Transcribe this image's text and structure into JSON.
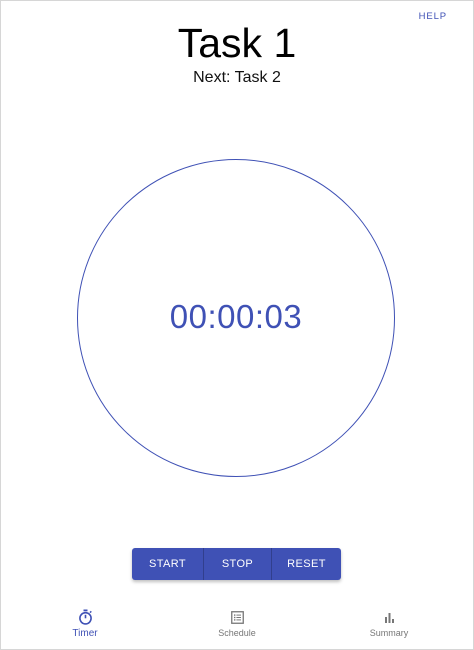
{
  "header": {
    "help_label": "HELP",
    "title": "Task 1",
    "next_task": "Next: Task 2"
  },
  "timer": {
    "display": "00:00:03"
  },
  "controls": {
    "start_label": "START",
    "stop_label": "STOP",
    "reset_label": "RESET"
  },
  "bottom_nav": {
    "items": [
      {
        "label": "Timer",
        "icon": "stopwatch-icon",
        "active": true
      },
      {
        "label": "Schedule",
        "icon": "list-icon",
        "active": false
      },
      {
        "label": "Summary",
        "icon": "bar-chart-icon",
        "active": false
      }
    ]
  },
  "colors": {
    "accent": "#3f51b5",
    "inactive_nav": "#777777",
    "background": "#ffffff"
  }
}
